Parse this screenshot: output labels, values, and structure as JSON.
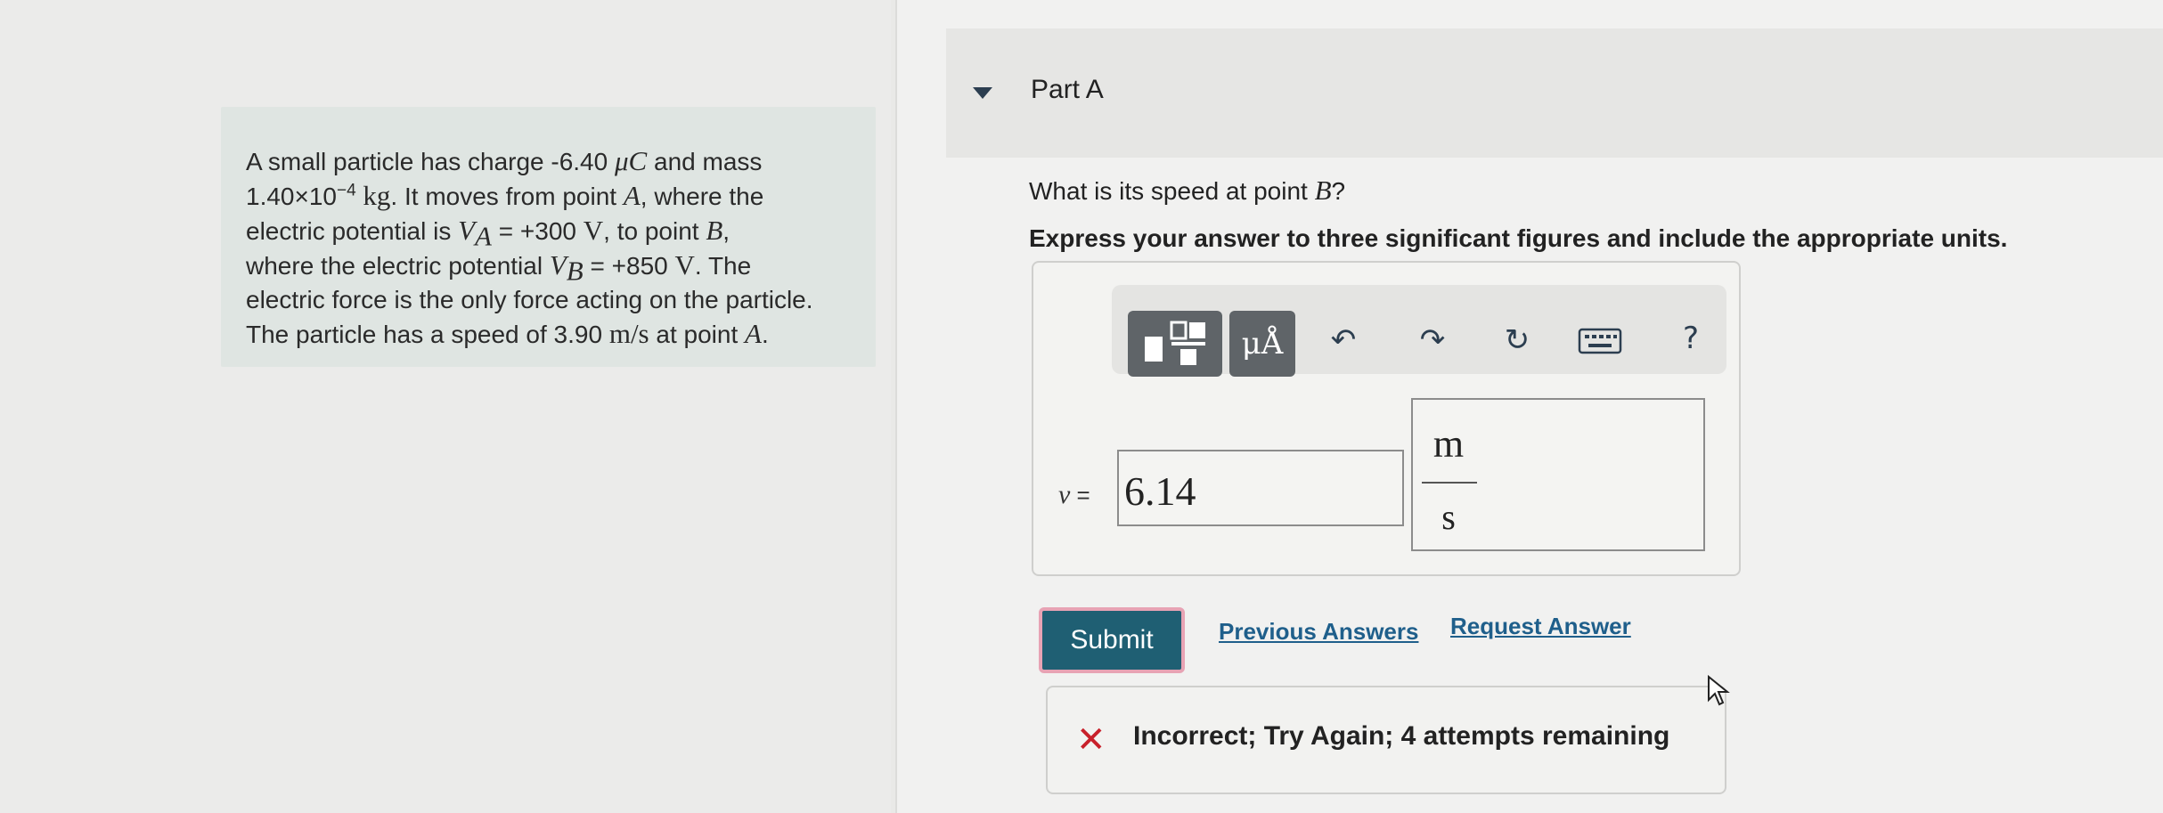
{
  "problem": {
    "line1_pre": "A small particle has charge -6.40 ",
    "line1_unit": "μC",
    "line1_post": " and mass",
    "line2_pre": "1.40×10",
    "line2_exp": "−4",
    "line2_unit": " kg",
    "line2_post": ". It moves from point ",
    "line2_A": "A",
    "line2_end": ", where the",
    "line3_pre": "electric potential is ",
    "line3_V": "V",
    "line3_sub": "A",
    "line3_val": " = +300 ",
    "line3_unit": "V",
    "line3_post": ", to point ",
    "line3_B": "B",
    "line3_end": ",",
    "line4_pre": "where the electric potential ",
    "line4_V": "V",
    "line4_sub": "B",
    "line4_val": " = +850 ",
    "line4_unit": "V",
    "line4_end": ". The",
    "line5": "electric force is the only force acting on the particle.",
    "line6_pre": "The particle has a speed of 3.90 ",
    "line6_unit": "m/s",
    "line6_post": " at point ",
    "line6_A": "A",
    "line6_end": "."
  },
  "part": {
    "title": "Part A"
  },
  "question": {
    "pre": "What is its speed at point ",
    "point": "B",
    "end": "?"
  },
  "instruction": "Express your answer to three significant figures and include the appropriate units.",
  "toolbar": {
    "units_label": "μÅ",
    "undo_glyph": "↶",
    "redo_glyph": "↷",
    "reset_glyph": "↻",
    "help_label": "?"
  },
  "answer": {
    "variable": "v",
    "equals": " =",
    "value": "6.14",
    "unit_numerator": "m",
    "unit_denominator": "s"
  },
  "actions": {
    "submit_label": "Submit",
    "previous_answers_label": "Previous Answers",
    "request_answer_label": "Request Answer"
  },
  "feedback": {
    "icon": "✕",
    "message": "Incorrect; Try Again; 4 attempts remaining"
  },
  "colors": {
    "submit_bg": "#1f5f73",
    "link": "#1f5f8b",
    "error": "#c8202a"
  }
}
